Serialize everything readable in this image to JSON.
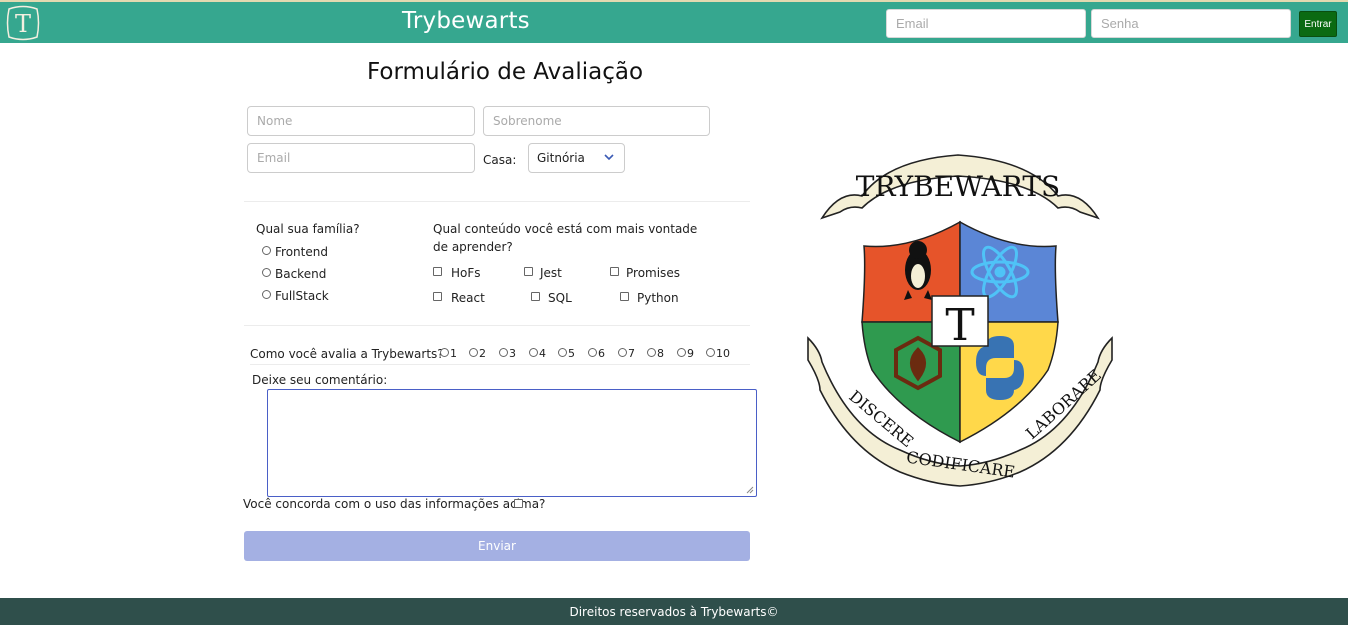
{
  "header": {
    "logo_letter": "T",
    "title": "Trybewarts",
    "email_placeholder": "Email",
    "password_placeholder": "Senha",
    "login_label": "Entrar"
  },
  "form": {
    "title": "Formulário de Avaliação",
    "name_placeholder": "Nome",
    "lastname_placeholder": "Sobrenome",
    "email_placeholder": "Email",
    "house_label": "Casa:",
    "house_selected": "Gitnória",
    "family_question": "Qual sua família?",
    "family_options": [
      "Frontend",
      "Backend",
      "FullStack"
    ],
    "content_question": "Qual conteúdo você está com mais vontade de aprender?",
    "content_options": [
      "HoFs",
      "Jest",
      "Promises",
      "React",
      "SQL",
      "Python"
    ],
    "rating_question": "Como você avalia a Trybewarts?",
    "rating_options": [
      "1",
      "2",
      "3",
      "4",
      "5",
      "6",
      "7",
      "8",
      "9",
      "10"
    ],
    "comment_label": "Deixe seu comentário:",
    "agreement_label": "Você concorda com o uso das informações acima?",
    "submit_label": "Enviar"
  },
  "crest": {
    "banner_top": "TRYBEWARTS",
    "center_letter": "T",
    "motto_left": "DISCERE",
    "motto_center": "CODIFICARE",
    "motto_right": "LABORARE"
  },
  "footer": {
    "text": "Direitos reservados à Trybewarts©"
  },
  "colors": {
    "header_bg": "#36a78f",
    "footer_bg": "#2f4f4b",
    "submit_bg": "#a4b0e3",
    "login_bg": "#0b6a12",
    "crest_orange": "#e6542a",
    "crest_blue": "#5b86d6",
    "crest_green": "#2f9a4f",
    "crest_yellow": "#ffd84a"
  }
}
